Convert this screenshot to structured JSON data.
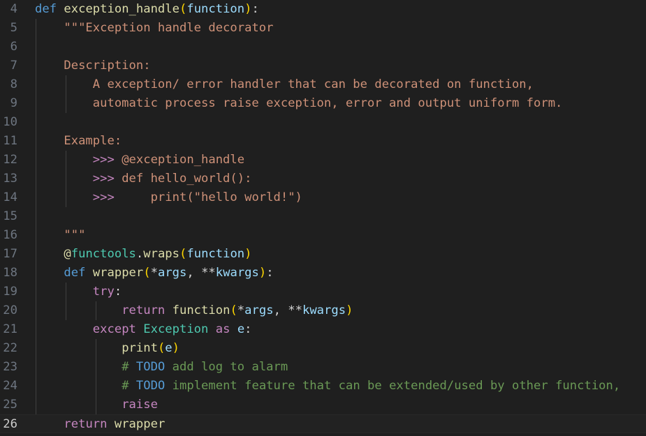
{
  "editor": {
    "language": "python",
    "current_line": "26",
    "lines": [
      {
        "n": "4",
        "tokens": [
          {
            "t": "def",
            "c": "kw"
          },
          {
            "t": " ",
            "c": "def"
          },
          {
            "t": "exception_handle",
            "c": "fn"
          },
          {
            "t": "(",
            "c": "p1"
          },
          {
            "t": "function",
            "c": "par"
          },
          {
            "t": ")",
            "c": "p1"
          },
          {
            "t": ":",
            "c": "op"
          }
        ]
      },
      {
        "n": "5",
        "tokens": [
          {
            "t": "    \"\"\"Exception handle decorator",
            "c": "str"
          }
        ]
      },
      {
        "n": "6",
        "tokens": []
      },
      {
        "n": "7",
        "tokens": [
          {
            "t": "    Description:",
            "c": "str"
          }
        ]
      },
      {
        "n": "8",
        "tokens": [
          {
            "t": "        A exception/ error handler that can be decorated on function,",
            "c": "str"
          }
        ]
      },
      {
        "n": "9",
        "tokens": [
          {
            "t": "        automatic process raise exception, error and output uniform form.",
            "c": "str"
          }
        ]
      },
      {
        "n": "10",
        "tokens": []
      },
      {
        "n": "11",
        "tokens": [
          {
            "t": "    Example:",
            "c": "str"
          }
        ]
      },
      {
        "n": "12",
        "tokens": [
          {
            "t": "        ",
            "c": "def"
          },
          {
            "t": ">>>",
            "c": "ctl"
          },
          {
            "t": " @exception_handle",
            "c": "str"
          }
        ]
      },
      {
        "n": "13",
        "tokens": [
          {
            "t": "        ",
            "c": "def"
          },
          {
            "t": ">>>",
            "c": "ctl"
          },
          {
            "t": " def hello_world():",
            "c": "str"
          }
        ]
      },
      {
        "n": "14",
        "tokens": [
          {
            "t": "        ",
            "c": "def"
          },
          {
            "t": ">>>",
            "c": "ctl"
          },
          {
            "t": "     print(\"hello world!\")",
            "c": "str"
          }
        ]
      },
      {
        "n": "15",
        "tokens": []
      },
      {
        "n": "16",
        "tokens": [
          {
            "t": "    \"\"\"",
            "c": "str"
          }
        ]
      },
      {
        "n": "17",
        "tokens": [
          {
            "t": "    ",
            "c": "def"
          },
          {
            "t": "@",
            "c": "fn"
          },
          {
            "t": "functools",
            "c": "cls"
          },
          {
            "t": ".",
            "c": "op"
          },
          {
            "t": "wraps",
            "c": "fn"
          },
          {
            "t": "(",
            "c": "p1"
          },
          {
            "t": "function",
            "c": "par"
          },
          {
            "t": ")",
            "c": "p1"
          }
        ]
      },
      {
        "n": "18",
        "tokens": [
          {
            "t": "    ",
            "c": "def"
          },
          {
            "t": "def",
            "c": "kw"
          },
          {
            "t": " ",
            "c": "def"
          },
          {
            "t": "wrapper",
            "c": "fn"
          },
          {
            "t": "(",
            "c": "p1"
          },
          {
            "t": "*",
            "c": "op"
          },
          {
            "t": "args",
            "c": "par"
          },
          {
            "t": ", ",
            "c": "op"
          },
          {
            "t": "**",
            "c": "op"
          },
          {
            "t": "kwargs",
            "c": "par"
          },
          {
            "t": ")",
            "c": "p1"
          },
          {
            "t": ":",
            "c": "op"
          }
        ]
      },
      {
        "n": "19",
        "tokens": [
          {
            "t": "        ",
            "c": "def"
          },
          {
            "t": "try",
            "c": "ctl"
          },
          {
            "t": ":",
            "c": "op"
          }
        ]
      },
      {
        "n": "20",
        "tokens": [
          {
            "t": "            ",
            "c": "def"
          },
          {
            "t": "return",
            "c": "ctl"
          },
          {
            "t": " ",
            "c": "def"
          },
          {
            "t": "function",
            "c": "fn"
          },
          {
            "t": "(",
            "c": "p1"
          },
          {
            "t": "*",
            "c": "op"
          },
          {
            "t": "args",
            "c": "par"
          },
          {
            "t": ", ",
            "c": "op"
          },
          {
            "t": "**",
            "c": "op"
          },
          {
            "t": "kwargs",
            "c": "par"
          },
          {
            "t": ")",
            "c": "p1"
          }
        ]
      },
      {
        "n": "21",
        "tokens": [
          {
            "t": "        ",
            "c": "def"
          },
          {
            "t": "except",
            "c": "ctl"
          },
          {
            "t": " ",
            "c": "def"
          },
          {
            "t": "Exception",
            "c": "cls"
          },
          {
            "t": " ",
            "c": "def"
          },
          {
            "t": "as",
            "c": "ctl"
          },
          {
            "t": " ",
            "c": "def"
          },
          {
            "t": "e",
            "c": "par"
          },
          {
            "t": ":",
            "c": "op"
          }
        ]
      },
      {
        "n": "22",
        "tokens": [
          {
            "t": "            ",
            "c": "def"
          },
          {
            "t": "print",
            "c": "fn"
          },
          {
            "t": "(",
            "c": "p1"
          },
          {
            "t": "e",
            "c": "par"
          },
          {
            "t": ")",
            "c": "p1"
          }
        ]
      },
      {
        "n": "23",
        "tokens": [
          {
            "t": "            ",
            "c": "def"
          },
          {
            "t": "# ",
            "c": "cm"
          },
          {
            "t": "TODO",
            "c": "todo"
          },
          {
            "t": " add log to alarm",
            "c": "cm"
          }
        ]
      },
      {
        "n": "24",
        "tokens": [
          {
            "t": "            ",
            "c": "def"
          },
          {
            "t": "# ",
            "c": "cm"
          },
          {
            "t": "TODO",
            "c": "todo"
          },
          {
            "t": " implement feature that can be extended/used by other function,",
            "c": "cm"
          }
        ]
      },
      {
        "n": "25",
        "tokens": [
          {
            "t": "            ",
            "c": "def"
          },
          {
            "t": "raise",
            "c": "ctl"
          }
        ]
      },
      {
        "n": "26",
        "tokens": [
          {
            "t": "    ",
            "c": "def"
          },
          {
            "t": "return",
            "c": "ctl"
          },
          {
            "t": " ",
            "c": "def"
          },
          {
            "t": "wrapper",
            "c": "fn"
          }
        ]
      }
    ]
  }
}
